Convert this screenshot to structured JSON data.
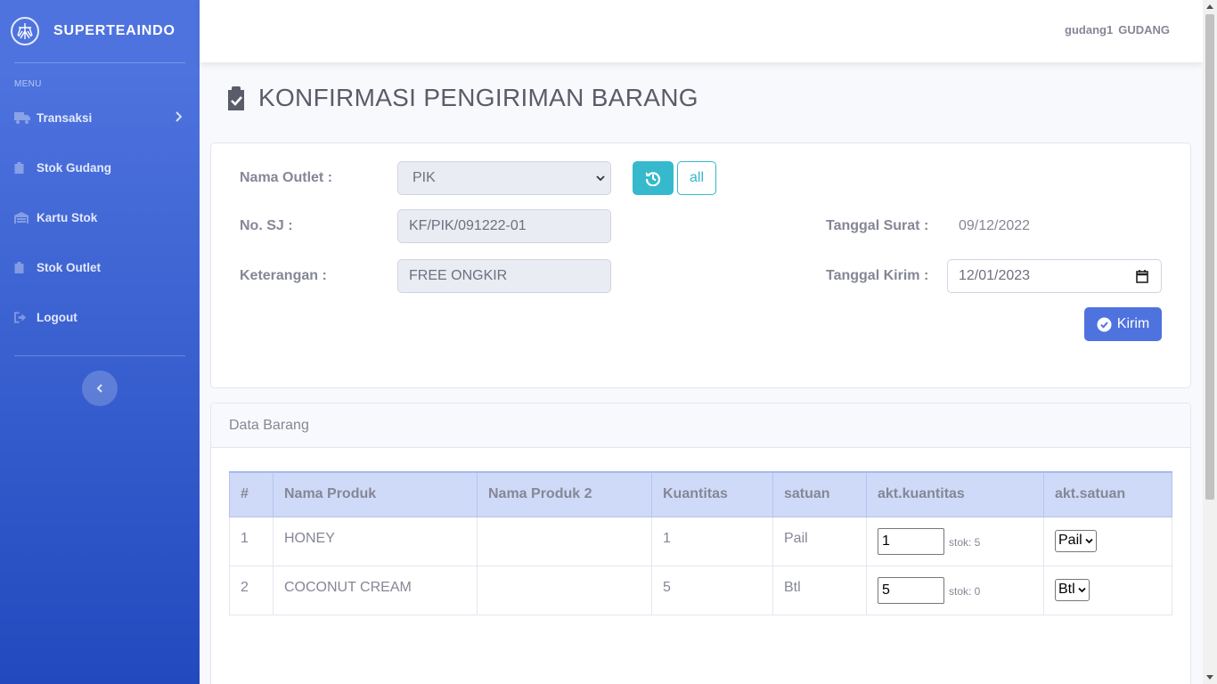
{
  "sidebar": {
    "brand": "SUPERTEAINDO",
    "heading": "MENU",
    "items": [
      {
        "label": "Transaksi",
        "icon": "truck-icon"
      },
      {
        "label": "Stok Gudang",
        "icon": "clipboard-icon"
      },
      {
        "label": "Kartu Stok",
        "icon": "warehouse-icon"
      },
      {
        "label": "Stok Outlet",
        "icon": "clipboard-icon"
      },
      {
        "label": "Logout",
        "icon": "sign-out-icon"
      }
    ]
  },
  "topbar": {
    "username": "gudang1",
    "role": "GUDANG"
  },
  "page": {
    "title": "KONFIRMASI PENGIRIMAN BARANG"
  },
  "form": {
    "outlet_label": "Nama Outlet :",
    "outlet_value": "PIK",
    "all_label": "all",
    "sj_label": "No. SJ :",
    "sj_value": "KF/PIK/091222-01",
    "tanggal_surat_label": "Tanggal Surat :",
    "tanggal_surat_value": "09/12/2022",
    "keterangan_label": "Keterangan :",
    "keterangan_value": "FREE ONGKIR",
    "tanggal_kirim_label": "Tanggal Kirim :",
    "tanggal_kirim_value": "12/01/2023",
    "kirim_label": "Kirim"
  },
  "data_card": {
    "title": "Data Barang",
    "columns": [
      "#",
      "Nama Produk",
      "Nama Produk 2",
      "Kuantitas",
      "satuan",
      "akt.kuantitas",
      "akt.satuan"
    ],
    "rows": [
      {
        "no": "1",
        "nama": "HONEY",
        "nama2": "",
        "qty": "1",
        "satuan": "Pail",
        "akt_qty": "1",
        "stok": "stok: 5",
        "akt_satuan": "Pail"
      },
      {
        "no": "2",
        "nama": "COCONUT CREAM",
        "nama2": "",
        "qty": "5",
        "satuan": "Btl",
        "akt_qty": "5",
        "stok": "stok: 0",
        "akt_satuan": "Btl"
      }
    ]
  },
  "colors": {
    "primary": "#4e73df",
    "info": "#36b9cc",
    "table_header": "#cfdaf8"
  }
}
